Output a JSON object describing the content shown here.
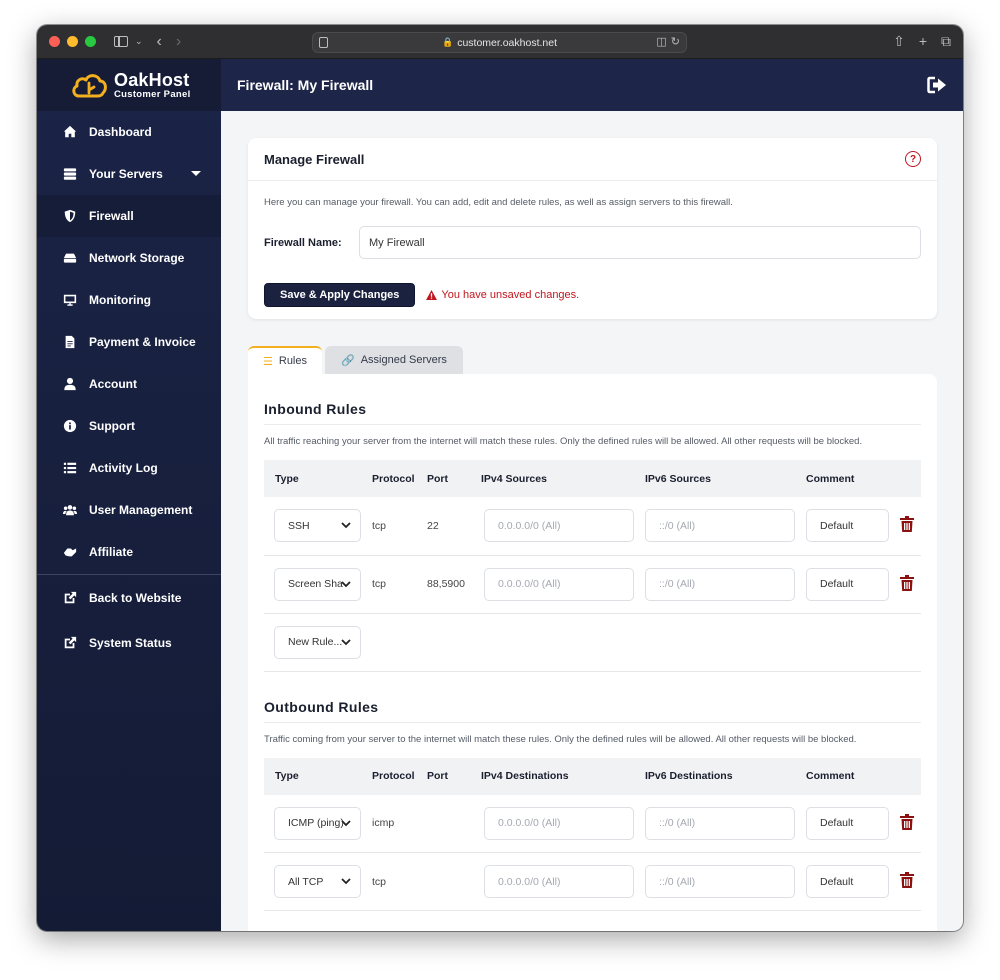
{
  "browser": {
    "url": "customer.oakhost.net"
  },
  "brand": {
    "name": "OakHost",
    "subtitle": "Customer Panel",
    "accent_color": "#f2b01e",
    "nav_bg": "#1b2447"
  },
  "sidebar": {
    "items": [
      {
        "label": "Dashboard",
        "icon": "home-icon"
      },
      {
        "label": "Your Servers",
        "icon": "servers-icon",
        "has_caret": true
      },
      {
        "label": "Firewall",
        "icon": "shield-icon",
        "active": true
      },
      {
        "label": "Network Storage",
        "icon": "storage-icon"
      },
      {
        "label": "Monitoring",
        "icon": "monitor-icon"
      },
      {
        "label": "Payment & Invoice",
        "icon": "invoice-icon"
      },
      {
        "label": "Account",
        "icon": "user-icon"
      },
      {
        "label": "Support",
        "icon": "info-icon"
      },
      {
        "label": "Activity Log",
        "icon": "list-icon"
      },
      {
        "label": "User Management",
        "icon": "users-icon"
      },
      {
        "label": "Affiliate",
        "icon": "handshake-icon"
      }
    ],
    "external_links": [
      {
        "label": "Back to Website",
        "icon": "external-link-icon"
      },
      {
        "label": "System Status",
        "icon": "external-link-icon"
      }
    ]
  },
  "header": {
    "title": "Firewall: My Firewall"
  },
  "manage_card": {
    "title": "Manage Firewall",
    "description": "Here you can manage your firewall. You can add, edit and delete rules, as well as assign servers to this firewall.",
    "name_label": "Firewall Name:",
    "name_value": "My Firewall",
    "save_label": "Save & Apply Changes",
    "warning_text": "You have unsaved changes.",
    "warning_color": "#c0161f"
  },
  "tabs": [
    {
      "label": "Rules",
      "icon": "list-icon",
      "active": true
    },
    {
      "label": "Assigned Servers",
      "icon": "link-icon",
      "active": false
    }
  ],
  "inbound": {
    "title": "Inbound Rules",
    "description": "All traffic reaching your server from the internet will match these rules. Only the defined rules will be allowed. All other requests will be blocked.",
    "columns": [
      "Type",
      "Protocol",
      "Port",
      "IPv4 Sources",
      "IPv6 Sources",
      "Comment"
    ],
    "rows": [
      {
        "type": "SSH",
        "protocol": "tcp",
        "port": "22",
        "ipv4_placeholder": "0.0.0.0/0 (All)",
        "ipv6_placeholder": "::/0 (All)",
        "comment": "Default"
      },
      {
        "type": "Screen Sharing",
        "protocol": "tcp",
        "port": "88,5900",
        "ipv4_placeholder": "0.0.0.0/0 (All)",
        "ipv6_placeholder": "::/0 (All)",
        "comment": "Default"
      }
    ],
    "new_rule_label": "New Rule..."
  },
  "outbound": {
    "title": "Outbound Rules",
    "description": "Traffic coming from your server to the internet will match these rules. Only the defined rules will be allowed. All other requests will be blocked.",
    "columns": [
      "Type",
      "Protocol",
      "Port",
      "IPv4 Destinations",
      "IPv6 Destinations",
      "Comment"
    ],
    "rows": [
      {
        "type": "ICMP (ping)",
        "protocol": "icmp",
        "port": "",
        "ipv4_placeholder": "0.0.0.0/0 (All)",
        "ipv6_placeholder": "::/0 (All)",
        "comment": "Default"
      },
      {
        "type": "All TCP",
        "protocol": "tcp",
        "port": "",
        "ipv4_placeholder": "0.0.0.0/0 (All)",
        "ipv6_placeholder": "::/0 (All)",
        "comment": "Default"
      }
    ]
  }
}
